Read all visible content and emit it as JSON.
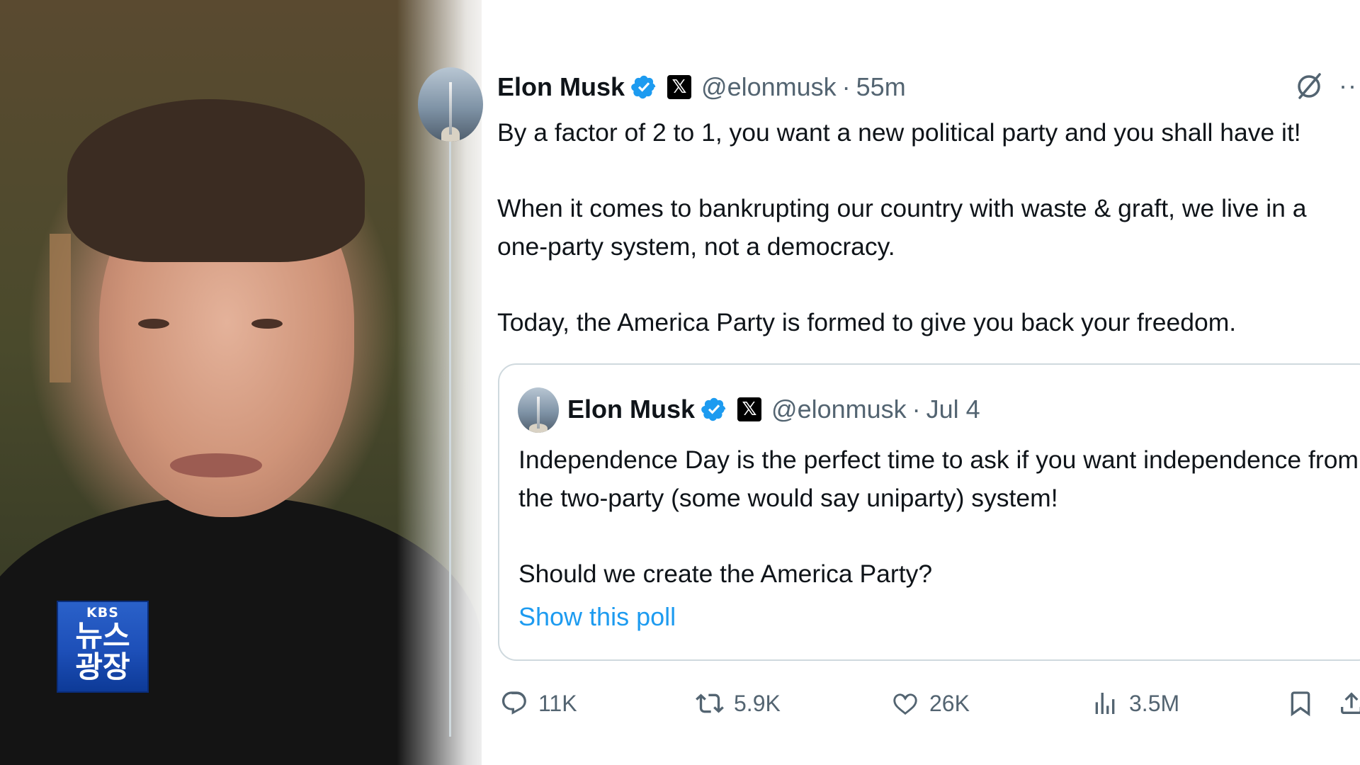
{
  "broadcast": {
    "logo_top": "KBS",
    "logo_line1": "뉴스",
    "logo_line2": "광장"
  },
  "tweet": {
    "author_name": "Elon Musk",
    "handle": "@elonmusk",
    "separator": "·",
    "time": "55m",
    "more": "···",
    "paragraphs": [
      "By a factor of 2 to 1, you want a new political party and you shall have it!",
      "When it comes to bankrupting our country with waste & graft, we live in a one-party system, not a democracy.",
      "Today, the America Party is formed to give you back your freedom."
    ],
    "quote": {
      "author_name": "Elon Musk",
      "handle": "@elonmusk",
      "separator": "·",
      "time": "Jul 4",
      "paragraphs": [
        "Independence Day is the perfect time to ask if you want independence from the two-party (some would say uniparty) system!",
        "Should we create the America Party?"
      ],
      "poll_link": "Show this poll"
    },
    "actions": {
      "replies": "11K",
      "retweets": "5.9K",
      "likes": "26K",
      "views": "3.5M"
    }
  },
  "colors": {
    "accent": "#1d9bf0",
    "muted": "#536471",
    "text": "#0f1419",
    "border": "#cfd9de",
    "logo_blue": "#1d4fb8"
  },
  "icons": [
    "verified-badge-icon",
    "x-logo-icon",
    "grok-icon",
    "more-icon",
    "reply-icon",
    "retweet-icon",
    "like-icon",
    "views-icon",
    "bookmark-icon",
    "share-icon"
  ]
}
